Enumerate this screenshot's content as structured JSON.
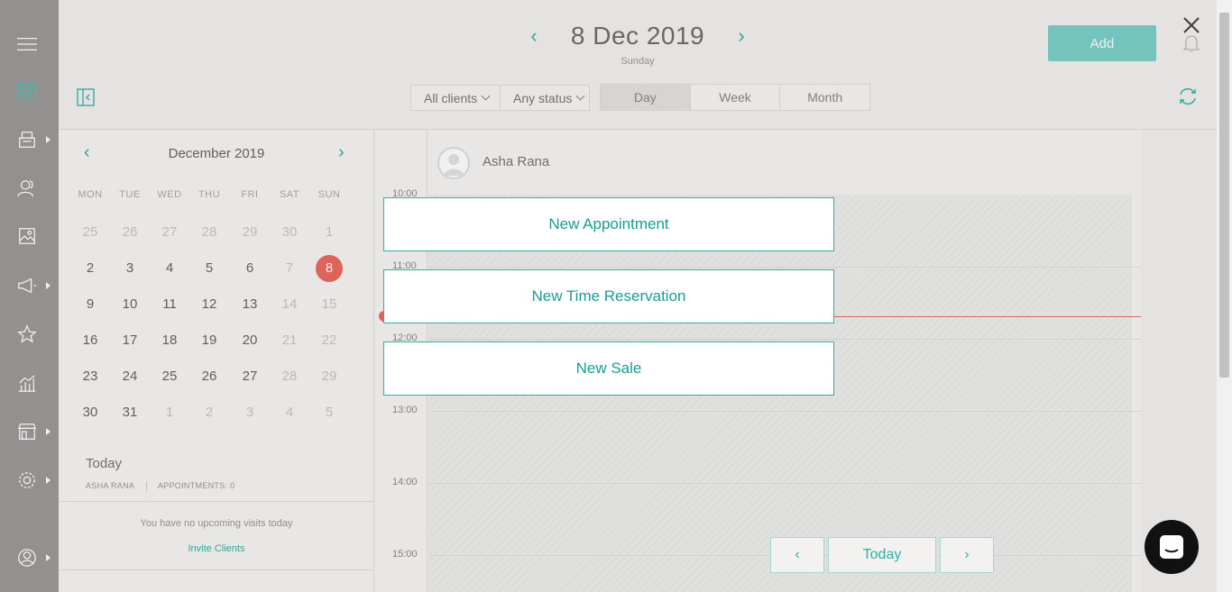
{
  "header": {
    "date": "8 Dec 2019",
    "weekday": "Sunday",
    "add_label": "Add",
    "prev_icon": "chevron-left-icon",
    "next_icon": "chevron-right-icon"
  },
  "filters": {
    "clients": "All clients",
    "status": "Any status"
  },
  "view_tabs": [
    "Day",
    "Week",
    "Month"
  ],
  "active_view": "Day",
  "calendar": {
    "month_label": "December 2019",
    "weekdays": [
      "MON",
      "TUE",
      "WED",
      "THU",
      "FRI",
      "SAT",
      "SUN"
    ],
    "weeks": [
      [
        "25",
        "26",
        "27",
        "28",
        "29",
        "30",
        "1"
      ],
      [
        "2",
        "3",
        "4",
        "5",
        "6",
        "7",
        "8"
      ],
      [
        "9",
        "10",
        "11",
        "12",
        "13",
        "14",
        "15"
      ],
      [
        "16",
        "17",
        "18",
        "19",
        "20",
        "21",
        "22"
      ],
      [
        "23",
        "24",
        "25",
        "26",
        "27",
        "28",
        "29"
      ],
      [
        "30",
        "31",
        "1",
        "2",
        "3",
        "4",
        "5"
      ]
    ],
    "selected": "8"
  },
  "today": {
    "label": "Today",
    "staff": "ASHA RANA",
    "appointments": "APPOINTMENTS: 0",
    "no_visits": "You have no upcoming visits today",
    "invite": "Invite Clients"
  },
  "schedule": {
    "staff_name": "Asha Rana",
    "times": [
      "10:00",
      "11:00",
      "12:00",
      "13:00",
      "14:00",
      "15:00"
    ]
  },
  "popup": {
    "new_appointment": "New Appointment",
    "new_time_reservation": "New Time Reservation",
    "new_sale": "New Sale"
  },
  "pager": {
    "today": "Today"
  },
  "colors": {
    "accent": "#31b0a8",
    "today_marker": "#ea6b5f",
    "sidebar": "#9c9b99"
  }
}
